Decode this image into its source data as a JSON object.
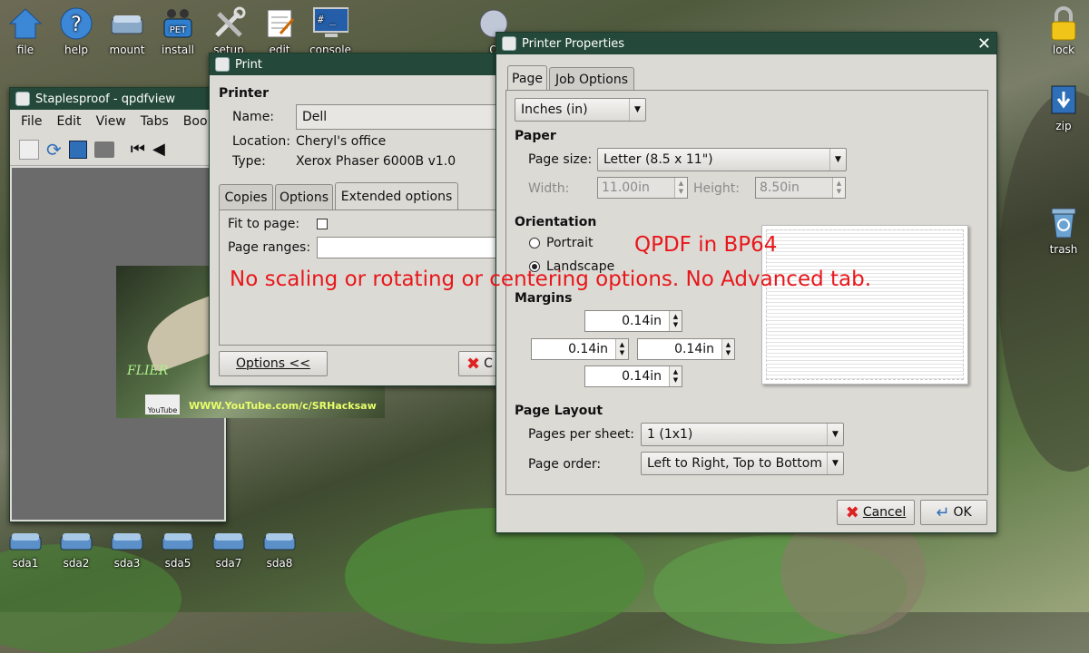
{
  "desktop": {
    "top_icons": [
      {
        "label": "file",
        "icon": "house-icon"
      },
      {
        "label": "help",
        "icon": "help-icon"
      },
      {
        "label": "mount",
        "icon": "drive-icon"
      },
      {
        "label": "install",
        "icon": "pet-icon",
        "badge": "PET"
      },
      {
        "label": "setup",
        "icon": "tools-icon"
      },
      {
        "label": "edit",
        "icon": "notepad-icon"
      },
      {
        "label": "console",
        "icon": "monitor-icon",
        "prompt": "# _"
      }
    ],
    "right_icons": [
      {
        "label": "lock",
        "icon": "lock-icon"
      },
      {
        "label": "zip",
        "icon": "zip-icon"
      },
      {
        "label": "trash",
        "icon": "trash-icon"
      }
    ],
    "drives": [
      {
        "label": "sda1"
      },
      {
        "label": "sda2"
      },
      {
        "label": "sda3"
      },
      {
        "label": "sda5"
      },
      {
        "label": "sda7"
      },
      {
        "label": "sda8"
      }
    ],
    "partial_icon_label": "Q"
  },
  "qpdfview": {
    "title": "Staplesproof - qpdfview",
    "menu": [
      "File",
      "Edit",
      "View",
      "Tabs",
      "Boo"
    ],
    "thumb_caption": "FLIER",
    "thumb_url": "WWW.YouTube.com/c/SRHacksaw",
    "thumb_logo": "YouTube"
  },
  "print": {
    "title": "Print",
    "printer_heading": "Printer",
    "name_label": "Name:",
    "name_value": "Dell",
    "location_label": "Location:",
    "location_value": "Cheryl's office",
    "type_label": "Type:",
    "type_value": "Xerox Phaser 6000B v1.0",
    "tabs": [
      "Copies",
      "Options",
      "Extended options"
    ],
    "fit_label": "Fit to page:",
    "ranges_label": "Page ranges:",
    "options_button": "Options <<",
    "cancel_partial": "C"
  },
  "props": {
    "title": "Printer Properties",
    "tabs": [
      "Page",
      "Job Options"
    ],
    "units": "Inches (in)",
    "paper_heading": "Paper",
    "page_size_label": "Page size:",
    "page_size_value": "Letter (8.5 x 11\")",
    "width_label": "Width:",
    "width_value": "11.00in",
    "height_label": "Height:",
    "height_value": "8.50in",
    "orientation_heading": "Orientation",
    "portrait_label": "Portrait",
    "landscape_label": "Landscape",
    "margins_heading": "Margins",
    "margin_top": "0.14in",
    "margin_left": "0.14in",
    "margin_right": "0.14in",
    "margin_bottom": "0.14in",
    "layout_heading": "Page Layout",
    "pps_label": "Pages per sheet:",
    "pps_value": "1 (1x1)",
    "order_label": "Page order:",
    "order_value": "Left to Right, Top to Bottom",
    "cancel_button": "Cancel",
    "ok_button": "OK"
  },
  "annotations": {
    "title": "QPDF in BP64",
    "note": "No scaling or rotating or centering options. No Advanced tab."
  },
  "colors": {
    "titlebar": "#24493a",
    "dialog_bg": "#dcdad5",
    "annotation": "#e8171b"
  }
}
